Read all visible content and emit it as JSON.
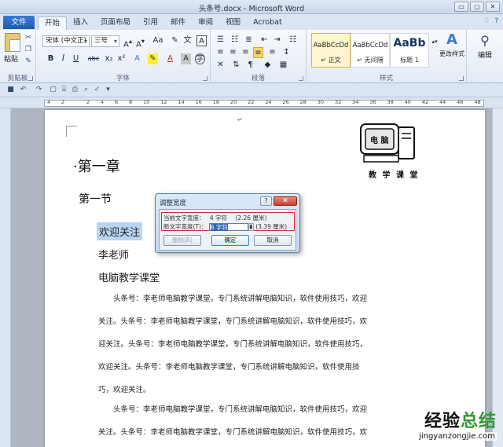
{
  "window": {
    "title": "头条号.docx - Microsoft Word",
    "buttons": [
      "▭",
      "▢",
      "✕"
    ]
  },
  "tabs": {
    "file": "文件",
    "items": [
      "开始",
      "插入",
      "页面布局",
      "引用",
      "邮件",
      "审阅",
      "视图",
      "Acrobat"
    ],
    "active": "开始",
    "right_icons": [
      "♢",
      "?"
    ]
  },
  "ribbon": {
    "clipboard": {
      "paste": "粘贴",
      "label": "剪贴板"
    },
    "font": {
      "name": "宋体 (中文正)",
      "size": "三号",
      "label": "字体",
      "buttons": [
        "B",
        "I",
        "U",
        "abc",
        "x₂",
        "x²"
      ]
    },
    "paragraph": {
      "label": "段落"
    },
    "styles": {
      "label": "样式",
      "items": [
        {
          "sample": "AaBbCcDd",
          "name": "↵ 正文",
          "active": true
        },
        {
          "sample": "AaBbCcDd",
          "name": "↵ 无间隔",
          "active": false
        },
        {
          "sample": "AaBb",
          "name": "标题 1",
          "active": false
        }
      ],
      "change": "更改样式"
    },
    "editing": {
      "label": "编辑"
    }
  },
  "ruler": {
    "marks": [
      "4",
      "2",
      "",
      "2",
      "4",
      "6",
      "8",
      "10",
      "12",
      "14",
      "16",
      "18",
      "20",
      "22",
      "24",
      "26",
      "28",
      "30",
      "32",
      "34",
      "36",
      "38",
      "40",
      "42",
      "44",
      "46",
      "48"
    ]
  },
  "document": {
    "logo_screen": "电 脑",
    "logo_caption": "教 学 课 堂",
    "chapter": "·第一章",
    "section": "第一节",
    "line1": "欢迎关注",
    "line2": "李老师",
    "line3": "电脑教学课堂",
    "para1": "头条号：李老师电脑教学课堂，专门系统讲解电脑知识，软件使用技巧，欢迎关注。头条号：李老师电脑教学课堂，专门系统讲解电脑知识，软件使用技巧，欢迎关注。头条号：李老师电脑教学课堂，专门系统讲解电脑知识，软件使用技巧，欢迎关注。头条号：李老师电脑教学课堂，专门系统讲解电脑知识，软件使用技巧，欢迎关注。",
    "para2": "头条号：李老师电脑教学课堂，专门系统讲解电脑知识，软件使用技巧，欢迎关注。头条号：李老师电脑教学课堂，专门系统讲解电脑知识，软件使用技巧，欢",
    "para_mark": "↵"
  },
  "dialog": {
    "title": "调整宽度",
    "help": "?",
    "close": "✕",
    "current_label": "当前文字宽度：",
    "current_value": "4 字符",
    "current_cm": "(2.26 厘米)",
    "new_label": "新文字宽度(T)：",
    "new_value": "6 字符",
    "new_cm": "(3.39 厘米)",
    "delete_btn": "删除(R)",
    "ok_btn": "确定",
    "cancel_btn": "取消"
  },
  "watermark": {
    "title_a": "经验",
    "title_b": "总结",
    "url": "jingyanzongjie.com"
  }
}
